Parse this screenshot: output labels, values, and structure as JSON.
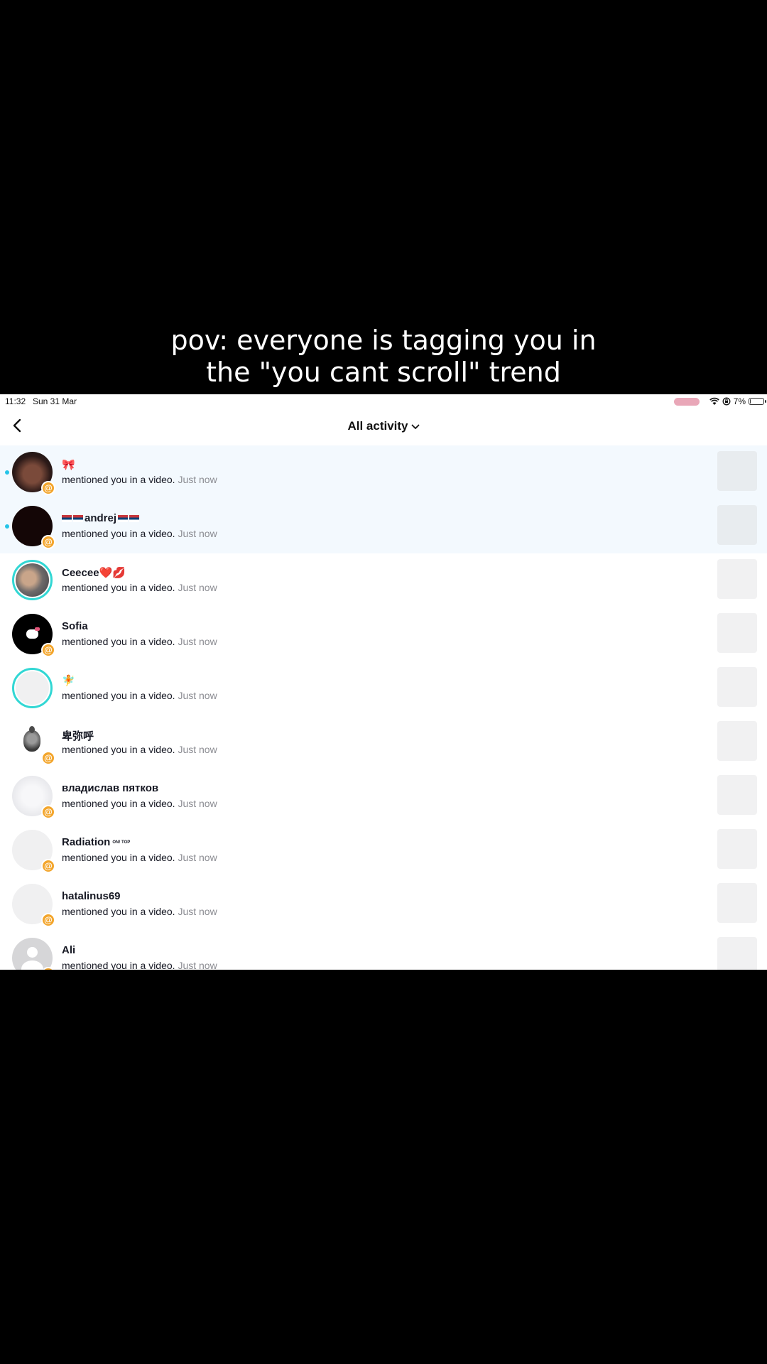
{
  "caption": {
    "line1": "pov: everyone is tagging you in",
    "line2": "the \"you cant scroll\" trend"
  },
  "status_bar": {
    "time": "11:32",
    "date": "Sun 31 Mar",
    "battery_percent_label": "7%",
    "battery_level": 0.07
  },
  "header": {
    "back_icon": "chevron-left-icon",
    "title": "All activity",
    "dropdown_icon": "chevron-down-icon"
  },
  "notifications": [
    {
      "name": "🎀",
      "message": "mentioned you in a video.",
      "time": "Just now",
      "unread": true,
      "avatar": "dark-photo",
      "badge": "@"
    },
    {
      "name_prefix": "flags",
      "name": "andrej",
      "message": "mentioned you in a video.",
      "time": "Just now",
      "unread": true,
      "avatar": "black",
      "badge": "@"
    },
    {
      "name": "Ceecee❤️💋",
      "message": "mentioned you in a video.",
      "time": "Just now",
      "unread": false,
      "avatar": "photo-ring",
      "badge": ""
    },
    {
      "name": "Sofia",
      "message": "mentioned you in a video.",
      "time": "Just now",
      "unread": false,
      "avatar": "black-hellokitty",
      "badge": "@"
    },
    {
      "name": "🧚",
      "message": "mentioned you in a video.",
      "time": "Just now",
      "unread": false,
      "avatar": "empty-ring",
      "badge": ""
    },
    {
      "name": "卑弥呼",
      "message": "mentioned you in a video.",
      "time": "Just now",
      "unread": false,
      "avatar": "white-figure",
      "badge": "@"
    },
    {
      "name": "владислав пятков",
      "message": "mentioned you in a video.",
      "time": "Just now",
      "unread": false,
      "avatar": "light-gray",
      "badge": "@"
    },
    {
      "name": "Radiation",
      "name_suffix": "ON! TOP",
      "message": "mentioned you in a video.",
      "time": "Just now",
      "unread": false,
      "avatar": "empty",
      "badge": "@"
    },
    {
      "name": "hatalinus69",
      "message": "mentioned you in a video.",
      "time": "Just now",
      "unread": false,
      "avatar": "empty",
      "badge": "@"
    },
    {
      "name": "Ali",
      "message": "mentioned you in a video.",
      "time": "Just now",
      "unread": false,
      "avatar": "default-person",
      "badge": "@"
    }
  ]
}
